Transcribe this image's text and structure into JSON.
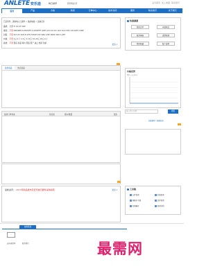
{
  "header": {
    "brand_en": "ANLETE",
    "brand_cn": "安乐迪",
    "login_label": "每日推荐",
    "login_value": "【登录提示】",
    "top_links": [
      "设为首页",
      "加入收藏",
      "联系我们"
    ]
  },
  "nav": {
    "tabs": [
      "首页",
      "产品",
      "方案",
      "新闻",
      "订单中心",
      "技术支持",
      "服务",
      "联系我们",
      "关于我们"
    ]
  },
  "filter": {
    "row1": "已选条件：通用电子元器件 > 集成电路 > 运放芯片",
    "row2_key": "品牌：",
    "row2_vals": "全部  TI  AD  ST  NXP",
    "row3_key": "类别：",
    "row3_hl": "不限",
    "row3_vals": "PNP/NPN  N-MOSFET  P-MOSFET  IGBT  LDO  DC-DC  ADC  DAC  MCU  OP-AMP  COMP",
    "row4_key": "封装：",
    "row4_hl": "不限",
    "row4_vals": "SOT-23  SOP-8  QFN  TSSOP  DIP  SMD  CHIP  0805  0603  LQFP",
    "row5_key": "价格：",
    "row5_hl": "不限",
    "row5_vals": "1元以下  1-5元  5-10元  10-20元  20元以上",
    "row6_key": "其他：",
    "row6_hl": "不限",
    "row6_vals": "现货  新品  特价  原装  国产  进口  热销  包邮",
    "more": "更多 ▾"
  },
  "quick": {
    "title": "快速通道",
    "buttons": [
      "我的订单",
      "申请样品",
      "联系客服",
      "发票管理",
      "我的收藏",
      "账户设置"
    ]
  },
  "panel_a": {
    "tabs": [
      "最新商品",
      "热卖商品"
    ]
  },
  "price_chart": {
    "title": "价格走势",
    "subtitle": "单价（元/pcs）"
  },
  "chart_data": {
    "type": "line",
    "title": "价格走势",
    "xlabel": "",
    "ylabel": "单价（元/pcs）",
    "x": [
      1,
      2,
      3,
      4,
      5,
      6
    ],
    "series": [
      {
        "values": [
          0,
          0,
          0,
          0,
          0,
          0
        ]
      }
    ],
    "ylim": [
      0,
      5
    ],
    "grid": true
  },
  "panel_b": {
    "tab1": "最新订单状态",
    "tab2": "供应商",
    "tab3": "报价/数量",
    "tab4": "更多"
  },
  "search": {
    "placeholder": "输入型号/品牌",
    "button": "搜索",
    "link": "高级搜索 / 批量查询"
  },
  "news": {
    "title_plain": "最新资讯：",
    "title_hl": "2013年新品发布及安乐迪元器件采购指南",
    "more": "更多 ▾"
  },
  "tools": {
    "title": "工具箱",
    "items": [
      "元件查询",
      "封装查询",
      "规格书下载",
      "库存查询",
      "在线报价",
      "技术文档"
    ]
  },
  "footer": {
    "tab": "友情链接",
    "captions": [
      "安乐迪官网",
      "联系我们"
    ]
  },
  "watermark": "最需网"
}
